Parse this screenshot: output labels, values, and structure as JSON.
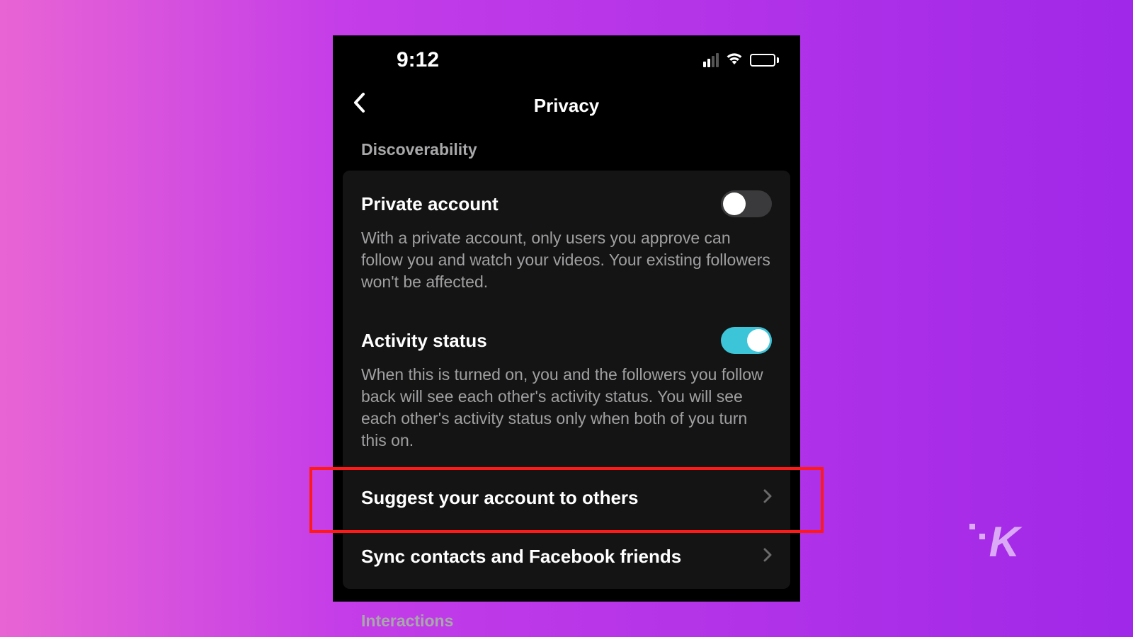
{
  "status": {
    "time": "9:12"
  },
  "nav": {
    "title": "Privacy"
  },
  "sections": {
    "discoverability": {
      "label": "Discoverability",
      "items": {
        "private_account": {
          "title": "Private account",
          "description": "With a private account, only users you approve can follow you and watch your videos. Your existing followers won't be affected.",
          "enabled": false
        },
        "activity_status": {
          "title": "Activity status",
          "description": "When this is turned on, you and the followers you follow back will see each other's activity status. You will see each other's activity status only when both of you turn this on.",
          "enabled": true
        },
        "suggest_account": {
          "title": "Suggest your account to others"
        },
        "sync_contacts": {
          "title": "Sync contacts and Facebook friends"
        }
      }
    },
    "interactions": {
      "label": "Interactions"
    }
  },
  "watermark": "K"
}
